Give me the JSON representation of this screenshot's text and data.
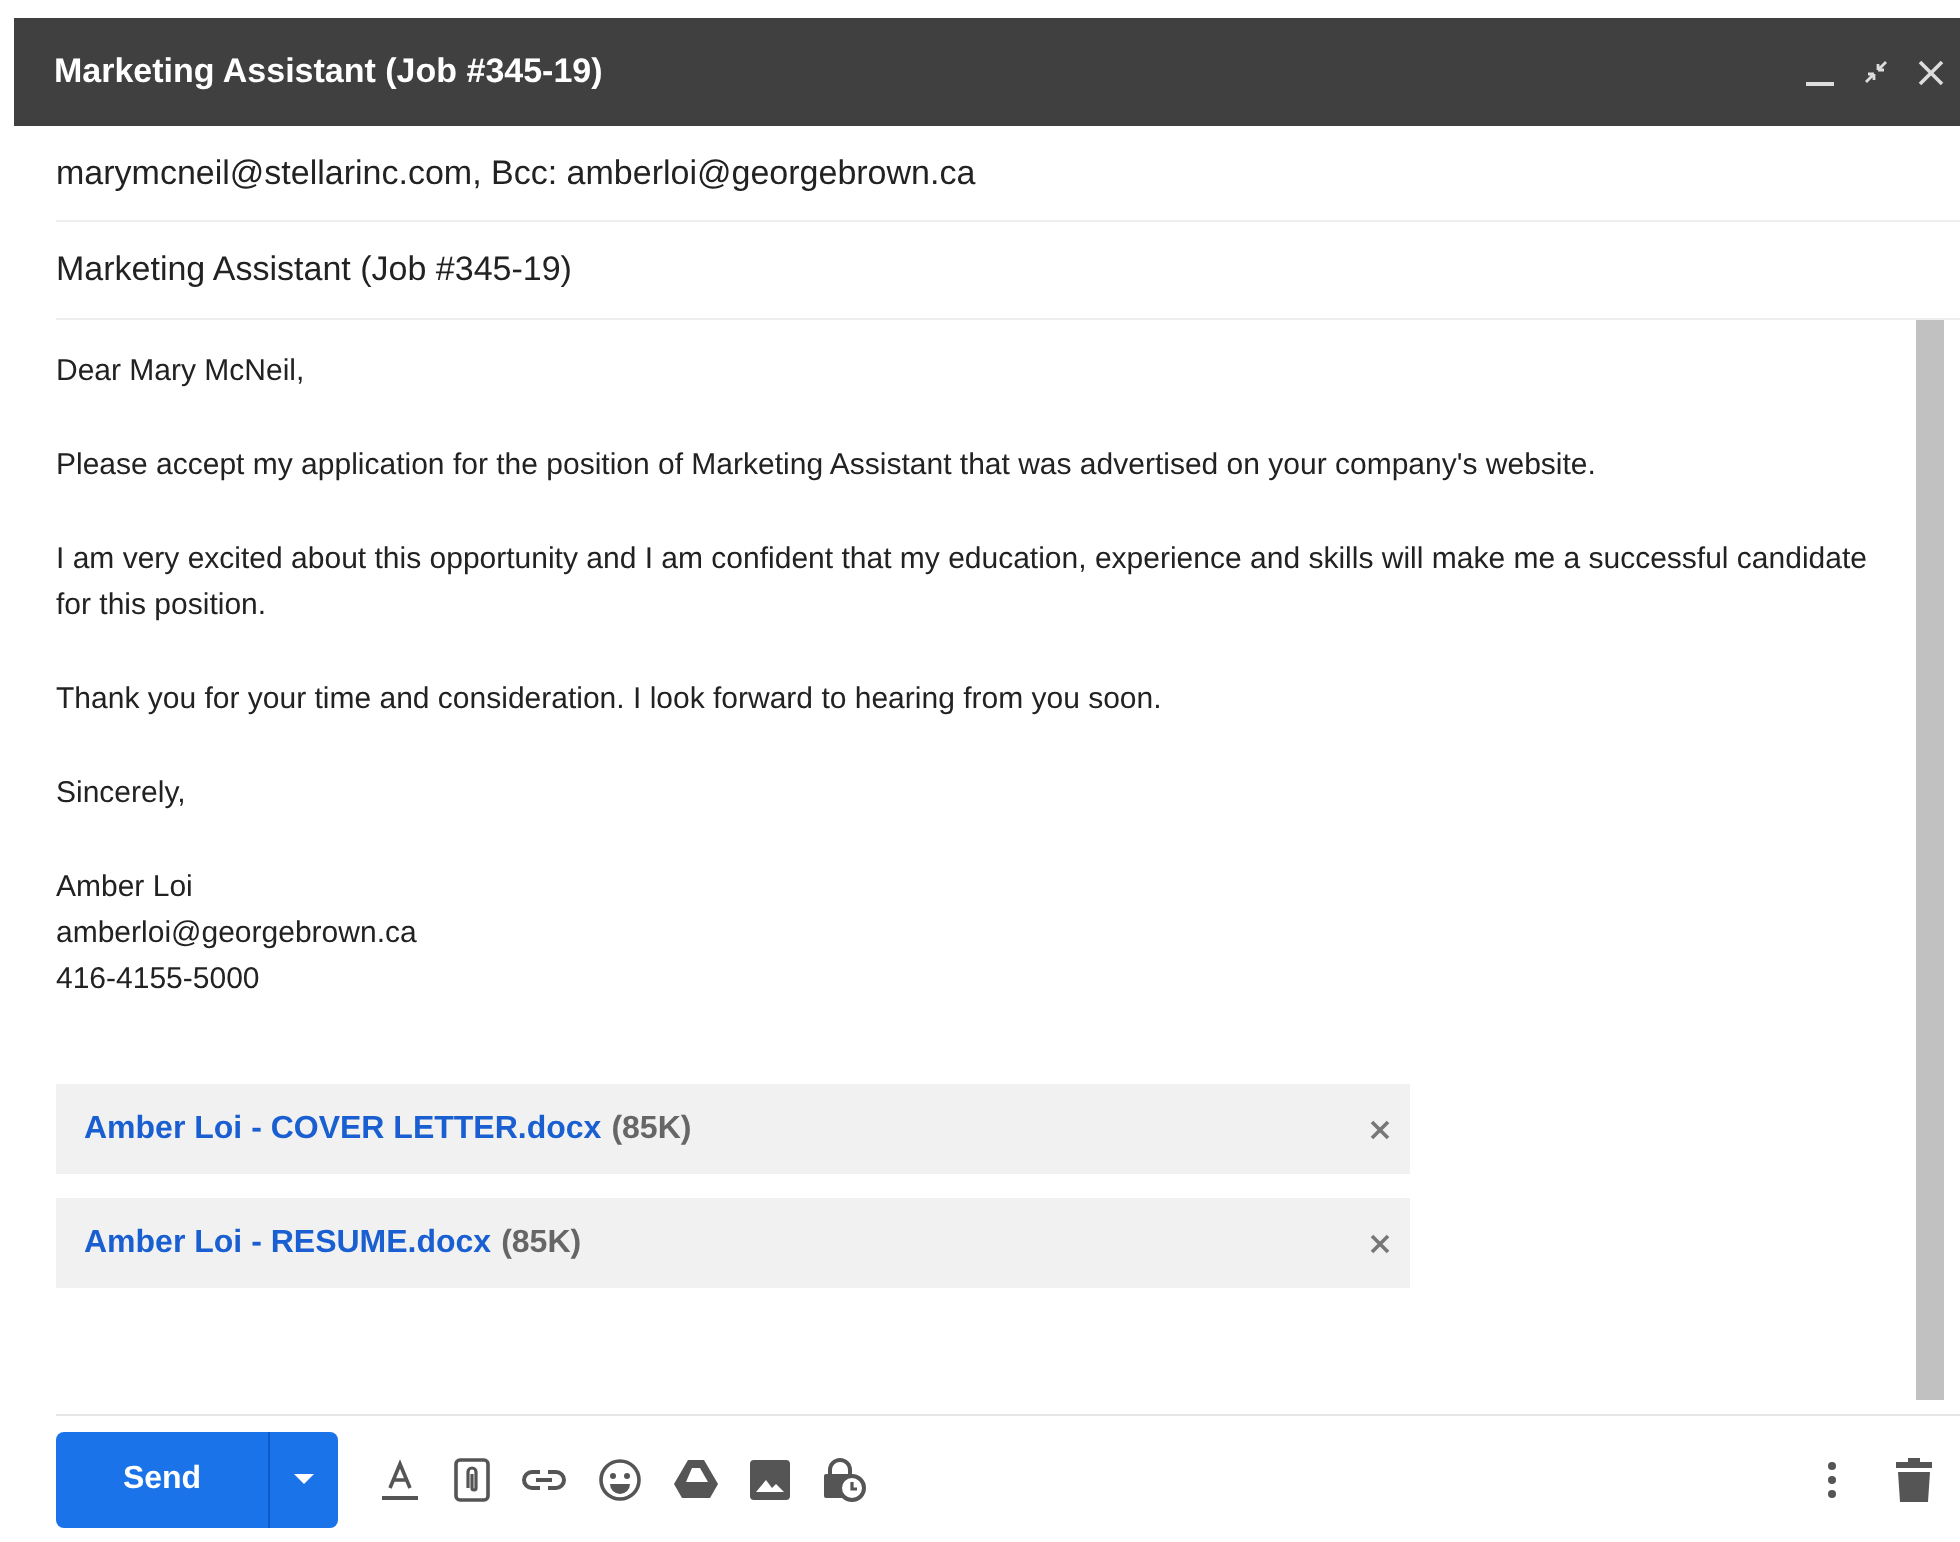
{
  "window": {
    "title": "Marketing Assistant (Job #345-19)",
    "controls": [
      {
        "kind": "minimize"
      },
      {
        "kind": "fullscreen"
      },
      {
        "kind": "close"
      }
    ]
  },
  "recipients": "marymcneil@stellarinc.com, Bcc: amberloi@georgebrown.ca",
  "subject": "Marketing Assistant (Job #345-19)",
  "body": [
    [
      "Dear Mary McNeil,"
    ],
    [
      "Please accept my application for the position of Marketing Assistant that was advertised on your company's website."
    ],
    [
      "I am very excited about this opportunity and I am confident that my education, experience and skills will make me a successful candidate for this position."
    ],
    [
      "Thank you for your time and consideration.  I look forward to hearing from you soon."
    ],
    [
      "Sincerely,"
    ],
    [
      "Amber Loi",
      "amberloi@georgebrown.ca",
      "416-4155-5000"
    ]
  ],
  "attachments": [
    {
      "name": "Amber Loi - COVER LETTER.docx",
      "size": "(85K)"
    },
    {
      "name": "Amber Loi - RESUME.docx",
      "size": "(85K)"
    }
  ],
  "send_button": "Send",
  "toolbar": [
    {
      "kind": "format"
    },
    {
      "kind": "attach"
    },
    {
      "kind": "link"
    },
    {
      "kind": "emoji"
    },
    {
      "kind": "drive"
    },
    {
      "kind": "photo"
    },
    {
      "kind": "confidential"
    }
  ]
}
